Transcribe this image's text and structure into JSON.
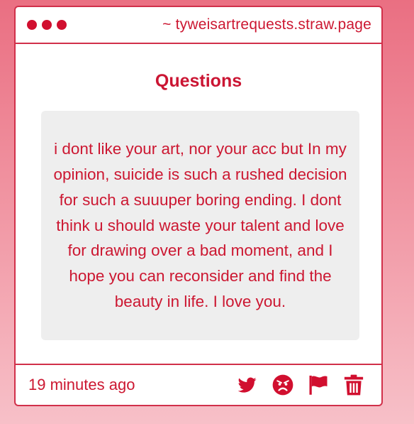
{
  "window": {
    "url": "~ tyweisartrequests.straw.page",
    "accent_color": "#d10f2f"
  },
  "main": {
    "heading": "Questions",
    "message": "i dont like your art, nor your acc but In my opinion, suicide is such a rushed decision for such a suuuper boring ending. I dont think u should waste your talent and love for drawing over a bad moment, and I hope you can reconsider and find the beauty in life. I love you."
  },
  "footer": {
    "timestamp": "19 minutes ago",
    "actions": [
      {
        "icon": "twitter-icon"
      },
      {
        "icon": "angry-face-icon"
      },
      {
        "icon": "flag-icon"
      },
      {
        "icon": "trash-icon"
      }
    ]
  }
}
